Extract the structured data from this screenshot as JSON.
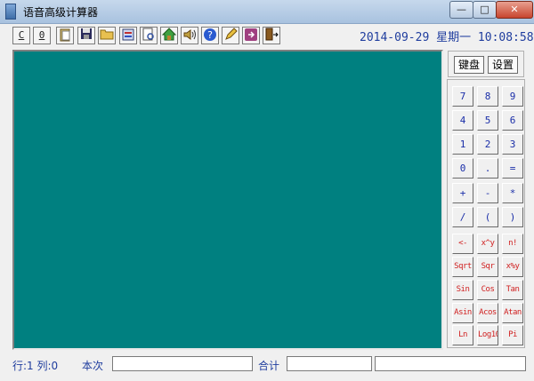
{
  "window": {
    "title": "语音高级计算器",
    "min_label": "—",
    "max_label": "□",
    "close_label": "✕"
  },
  "toolbar": {
    "buttons": [
      {
        "name": "clear-c-button",
        "label": "C"
      },
      {
        "name": "clear-zero-button",
        "label": "0"
      },
      {
        "name": "paste-icon",
        "label": ""
      },
      {
        "name": "save-icon",
        "label": ""
      },
      {
        "name": "open-folder-icon",
        "label": ""
      },
      {
        "name": "print-icon",
        "label": ""
      },
      {
        "name": "preview-icon",
        "label": ""
      },
      {
        "name": "home-icon",
        "label": ""
      },
      {
        "name": "speaker-icon",
        "label": ""
      },
      {
        "name": "help-icon",
        "label": ""
      },
      {
        "name": "pen-icon",
        "label": ""
      },
      {
        "name": "export-icon",
        "label": ""
      },
      {
        "name": "exit-icon",
        "label": ""
      }
    ],
    "datetime": "2014-09-29 星期一 10:08:58"
  },
  "side": {
    "keyboard_tab": "键盘",
    "settings_tab": "设置"
  },
  "keypad": {
    "rows": [
      [
        "7",
        "8",
        "9"
      ],
      [
        "4",
        "5",
        "6"
      ],
      [
        "1",
        "2",
        "3"
      ],
      [
        "0",
        ".",
        "="
      ],
      [
        "+",
        "-",
        "*"
      ],
      [
        "/",
        "(",
        ")"
      ],
      [
        "<-",
        "x^y",
        "n!"
      ],
      [
        "Sqrt",
        "Sqr",
        "x%y"
      ],
      [
        "Sin",
        "Cos",
        "Tan"
      ],
      [
        "Asin",
        "Acos",
        "Atan"
      ],
      [
        "Ln",
        "Log10",
        "Pi"
      ]
    ]
  },
  "status": {
    "row_col": "行:1 列:0",
    "current_label": "本次",
    "current_value": "",
    "total_label": "合计",
    "total_value": "",
    "extra_value": ""
  }
}
